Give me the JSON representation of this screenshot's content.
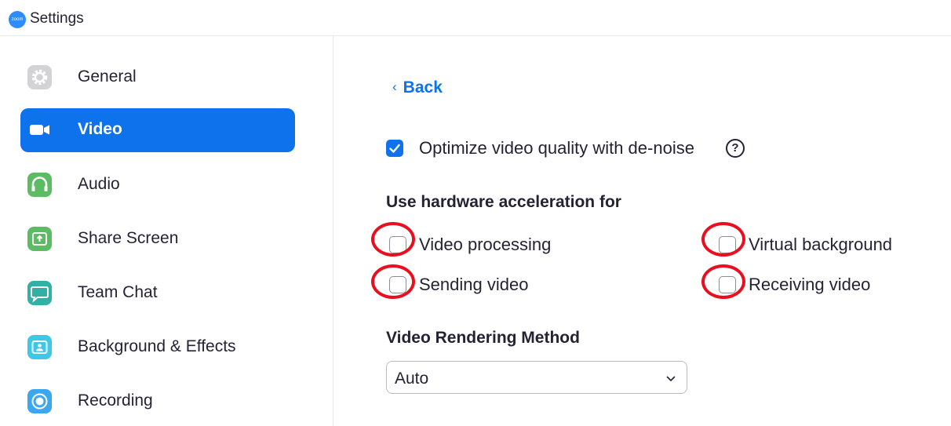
{
  "window": {
    "title": "Settings",
    "logo_text": "zoom"
  },
  "sidebar": {
    "items": [
      {
        "label": "General",
        "icon": "gear-icon",
        "active": false
      },
      {
        "label": "Video",
        "icon": "video-camera-icon",
        "active": true
      },
      {
        "label": "Audio",
        "icon": "headphones-icon",
        "active": false
      },
      {
        "label": "Share Screen",
        "icon": "share-screen-icon",
        "active": false
      },
      {
        "label": "Team Chat",
        "icon": "chat-bubble-icon",
        "active": false
      },
      {
        "label": "Background & Effects",
        "icon": "background-person-icon",
        "active": false
      },
      {
        "label": "Recording",
        "icon": "record-icon",
        "active": false
      }
    ]
  },
  "main": {
    "back_label": "Back",
    "denoise": {
      "label": "Optimize video quality with de-noise",
      "checked": true,
      "help_glyph": "?"
    },
    "hardware_accel": {
      "heading": "Use hardware acceleration for",
      "options": [
        {
          "label": "Video processing",
          "checked": false
        },
        {
          "label": "Virtual background",
          "checked": false
        },
        {
          "label": "Sending video",
          "checked": false
        },
        {
          "label": "Receiving video",
          "checked": false
        }
      ]
    },
    "rendering": {
      "heading": "Video Rendering Method",
      "selected": "Auto"
    }
  },
  "colors": {
    "accent": "#0e72ed",
    "highlight_ring": "#e8101e",
    "general_icon": "#d3d3d6",
    "audio_icon": "#5dbb63",
    "share_icon": "#5dbb63",
    "chat_icon": "#2fb1a6",
    "background_icon": "#3dc8e6",
    "recording_icon": "#3aa7f0"
  }
}
